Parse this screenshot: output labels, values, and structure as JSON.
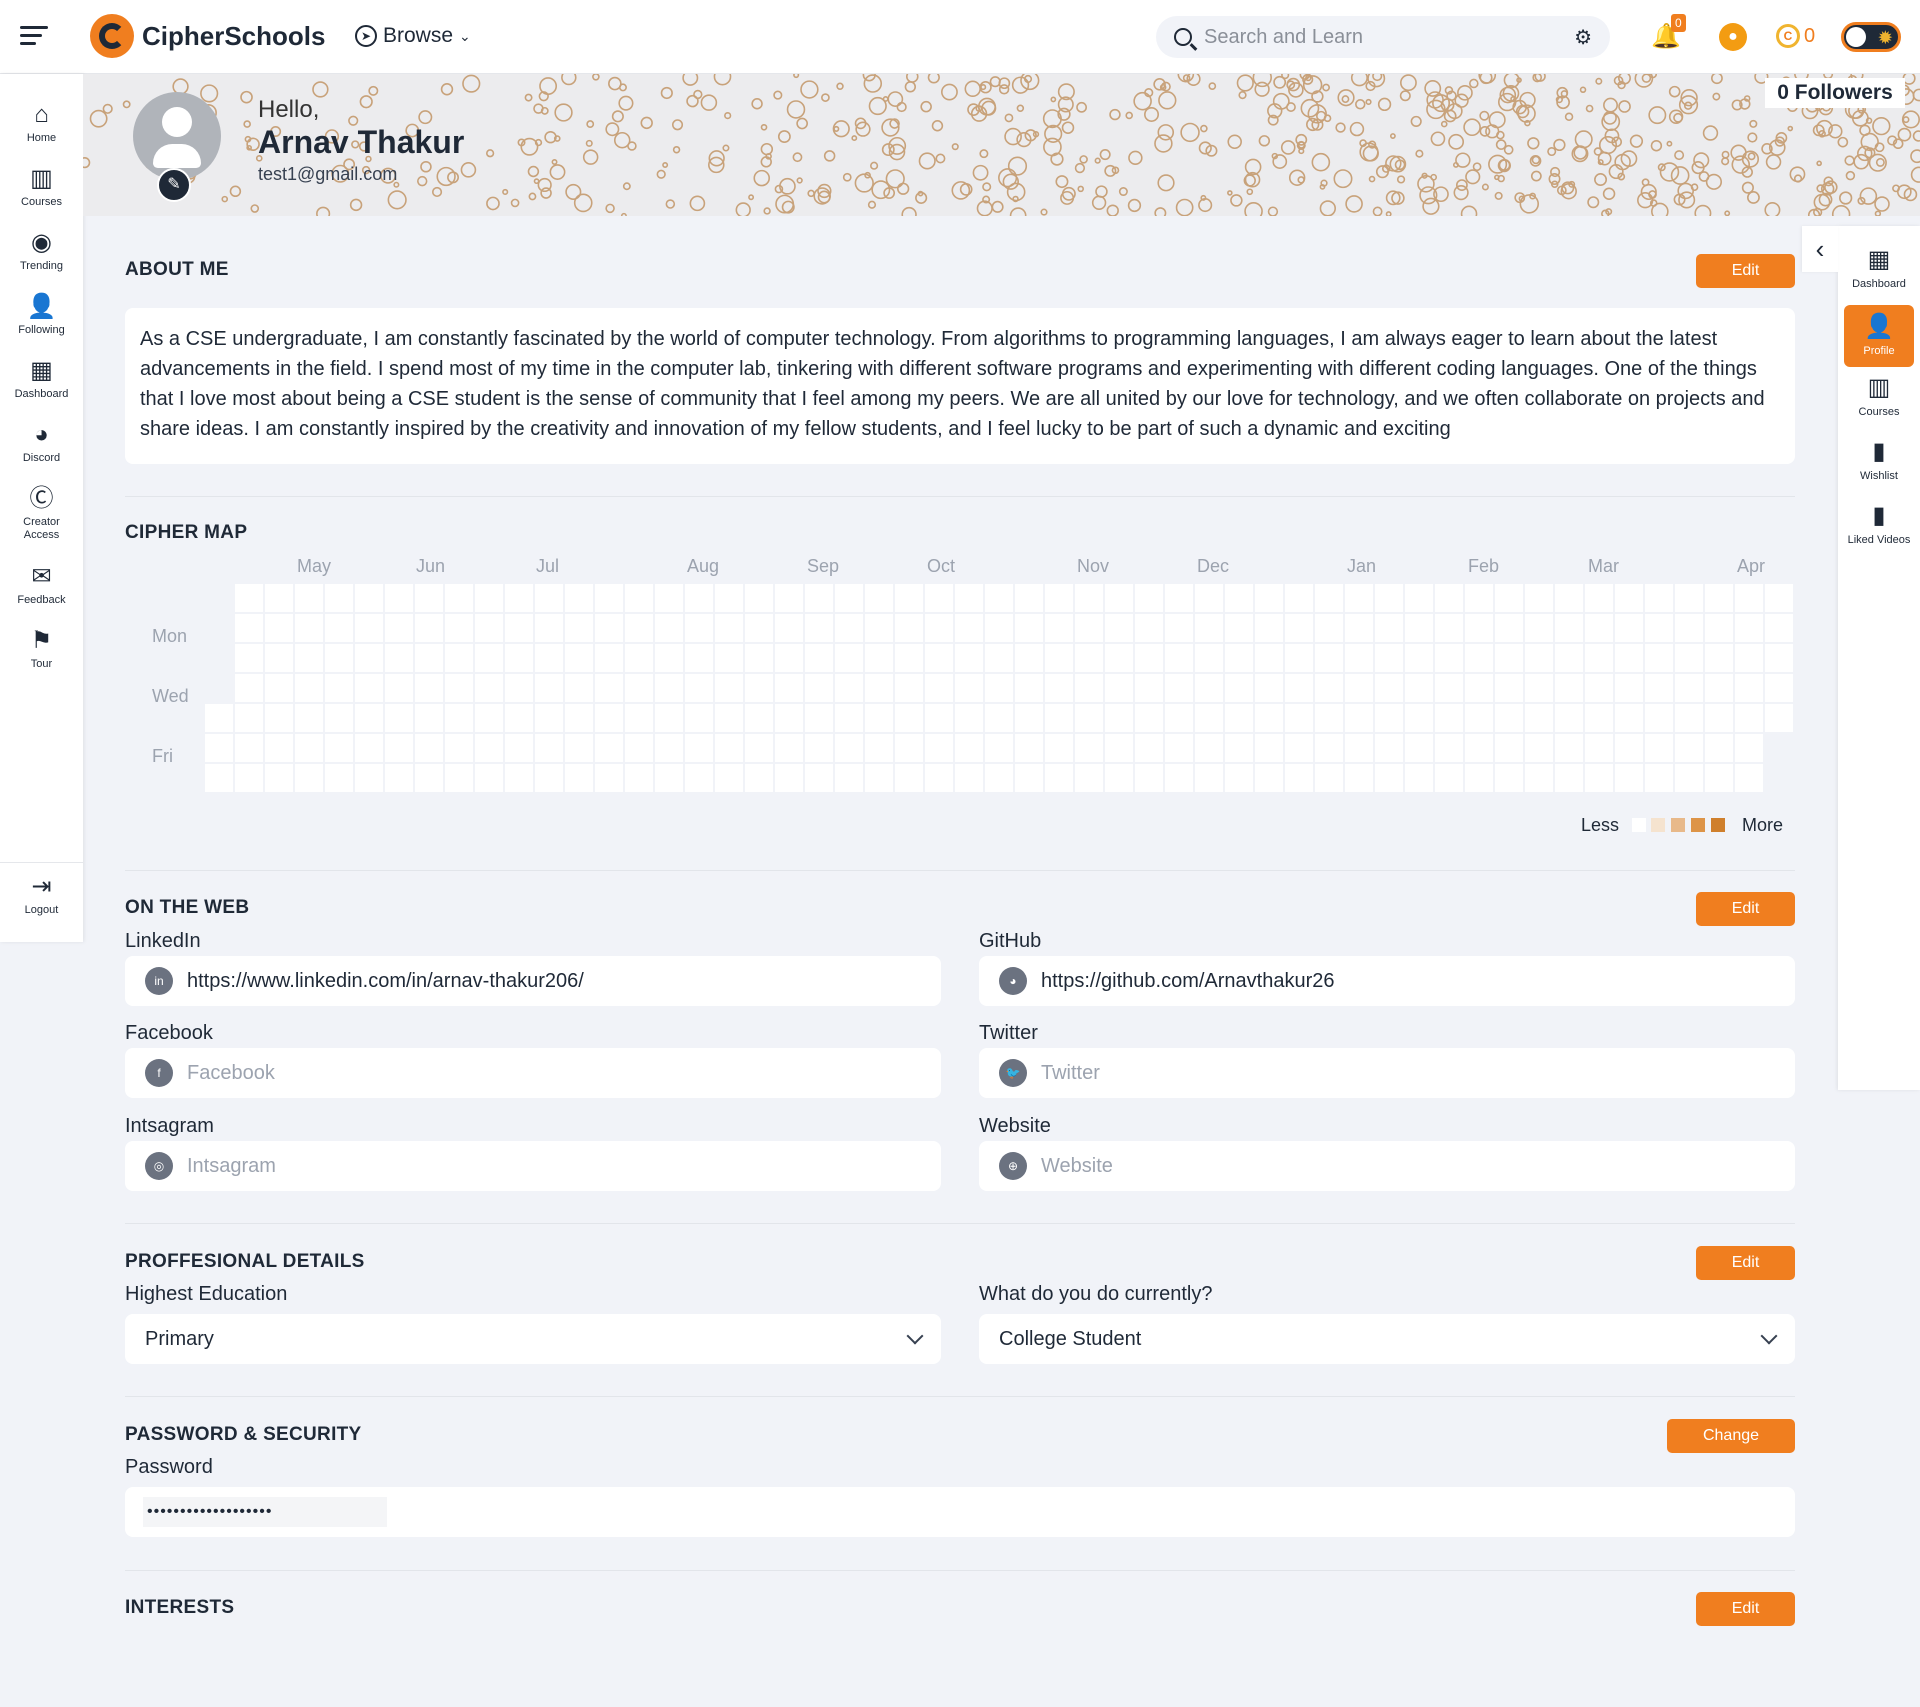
{
  "header": {
    "brand": "CipherSchools",
    "browse_label": "Browse",
    "search_placeholder": "Search and Learn",
    "notification_count": "0",
    "coins": "0"
  },
  "left_nav": [
    {
      "label": "Home",
      "icon": "home-icon"
    },
    {
      "label": "Courses",
      "icon": "books-icon"
    },
    {
      "label": "Trending",
      "icon": "compass-icon"
    },
    {
      "label": "Following",
      "icon": "user-follow-icon"
    },
    {
      "label": "Dashboard",
      "icon": "dashboard-icon"
    },
    {
      "label": "Discord",
      "icon": "discord-icon"
    },
    {
      "label": "Creator Access",
      "icon": "creator-icon"
    },
    {
      "label": "Feedback",
      "icon": "feedback-icon"
    },
    {
      "label": "Tour",
      "icon": "signpost-icon"
    },
    {
      "label": "Logout",
      "icon": "logout-icon"
    }
  ],
  "profile": {
    "greeting": "Hello,",
    "name": "Arnav Thakur",
    "email": "test1@gmail.com",
    "followers": "0 Followers"
  },
  "right_nav": [
    {
      "label": "Dashboard",
      "icon": "dashboard-icon"
    },
    {
      "label": "Profile",
      "icon": "user-icon",
      "active": true
    },
    {
      "label": "Courses",
      "icon": "books-icon"
    },
    {
      "label": "Wishlist",
      "icon": "book-icon"
    },
    {
      "label": "Liked Videos",
      "icon": "book-heart-icon"
    }
  ],
  "about": {
    "title": "ABOUT ME",
    "edit_label": "Edit",
    "text": "As a CSE undergraduate, I am constantly fascinated by the world of computer technology. From algorithms to programming languages, I am always eager to learn about the latest advancements in the field. I spend most of my time in the computer lab, tinkering with different software programs and experimenting with different coding languages. One of the things that I love most about being a CSE student is the sense of community that I feel among my peers. We are all united by our love for technology, and we often collaborate on projects and share ideas. I am constantly inspired by the creativity and innovation of my fellow students, and I feel lucky to be part of such a dynamic and exciting"
  },
  "cipher_map": {
    "title": "CIPHER MAP",
    "months": [
      "May",
      "Jun",
      "Jul",
      "Aug",
      "Sep",
      "Oct",
      "Nov",
      "Dec",
      "Jan",
      "Feb",
      "Mar",
      "Apr"
    ],
    "days": [
      "Mon",
      "Wed",
      "Fri"
    ],
    "legend_less": "Less",
    "legend_more": "More",
    "legend_colors": [
      "#ffffff",
      "#f5e3cf",
      "#e8b98a",
      "#dd9448",
      "#cf7f2c"
    ]
  },
  "on_the_web": {
    "title": "ON THE WEB",
    "edit_label": "Edit",
    "fields": [
      {
        "label": "LinkedIn",
        "value": "https://www.linkedin.com/in/arnav-thakur206/",
        "placeholder": "",
        "icon": "linkedin-icon"
      },
      {
        "label": "GitHub",
        "value": "https://github.com/Arnavthakur26",
        "placeholder": "",
        "icon": "github-icon"
      },
      {
        "label": "Facebook",
        "value": "",
        "placeholder": "Facebook",
        "icon": "facebook-icon"
      },
      {
        "label": "Twitter",
        "value": "",
        "placeholder": "Twitter",
        "icon": "twitter-icon"
      },
      {
        "label": "Intsagram",
        "value": "",
        "placeholder": "Intsagram",
        "icon": "instagram-icon"
      },
      {
        "label": "Website",
        "value": "",
        "placeholder": "Website",
        "icon": "globe-icon"
      }
    ]
  },
  "professional": {
    "title": "PROFFESIONAL DETAILS",
    "edit_label": "Edit",
    "education_label": "Highest Education",
    "education_value": "Primary",
    "current_label": "What do you do currently?",
    "current_value": "College Student"
  },
  "security": {
    "title": "PASSWORD & SECURITY",
    "change_label": "Change",
    "password_label": "Password",
    "password_mask": "•••••••••••••••••••"
  },
  "interests": {
    "title": "INTERESTS",
    "edit_label": "Edit"
  },
  "colors": {
    "accent": "#f07e1f",
    "background": "#f1f3f8",
    "text": "#1f2937"
  }
}
